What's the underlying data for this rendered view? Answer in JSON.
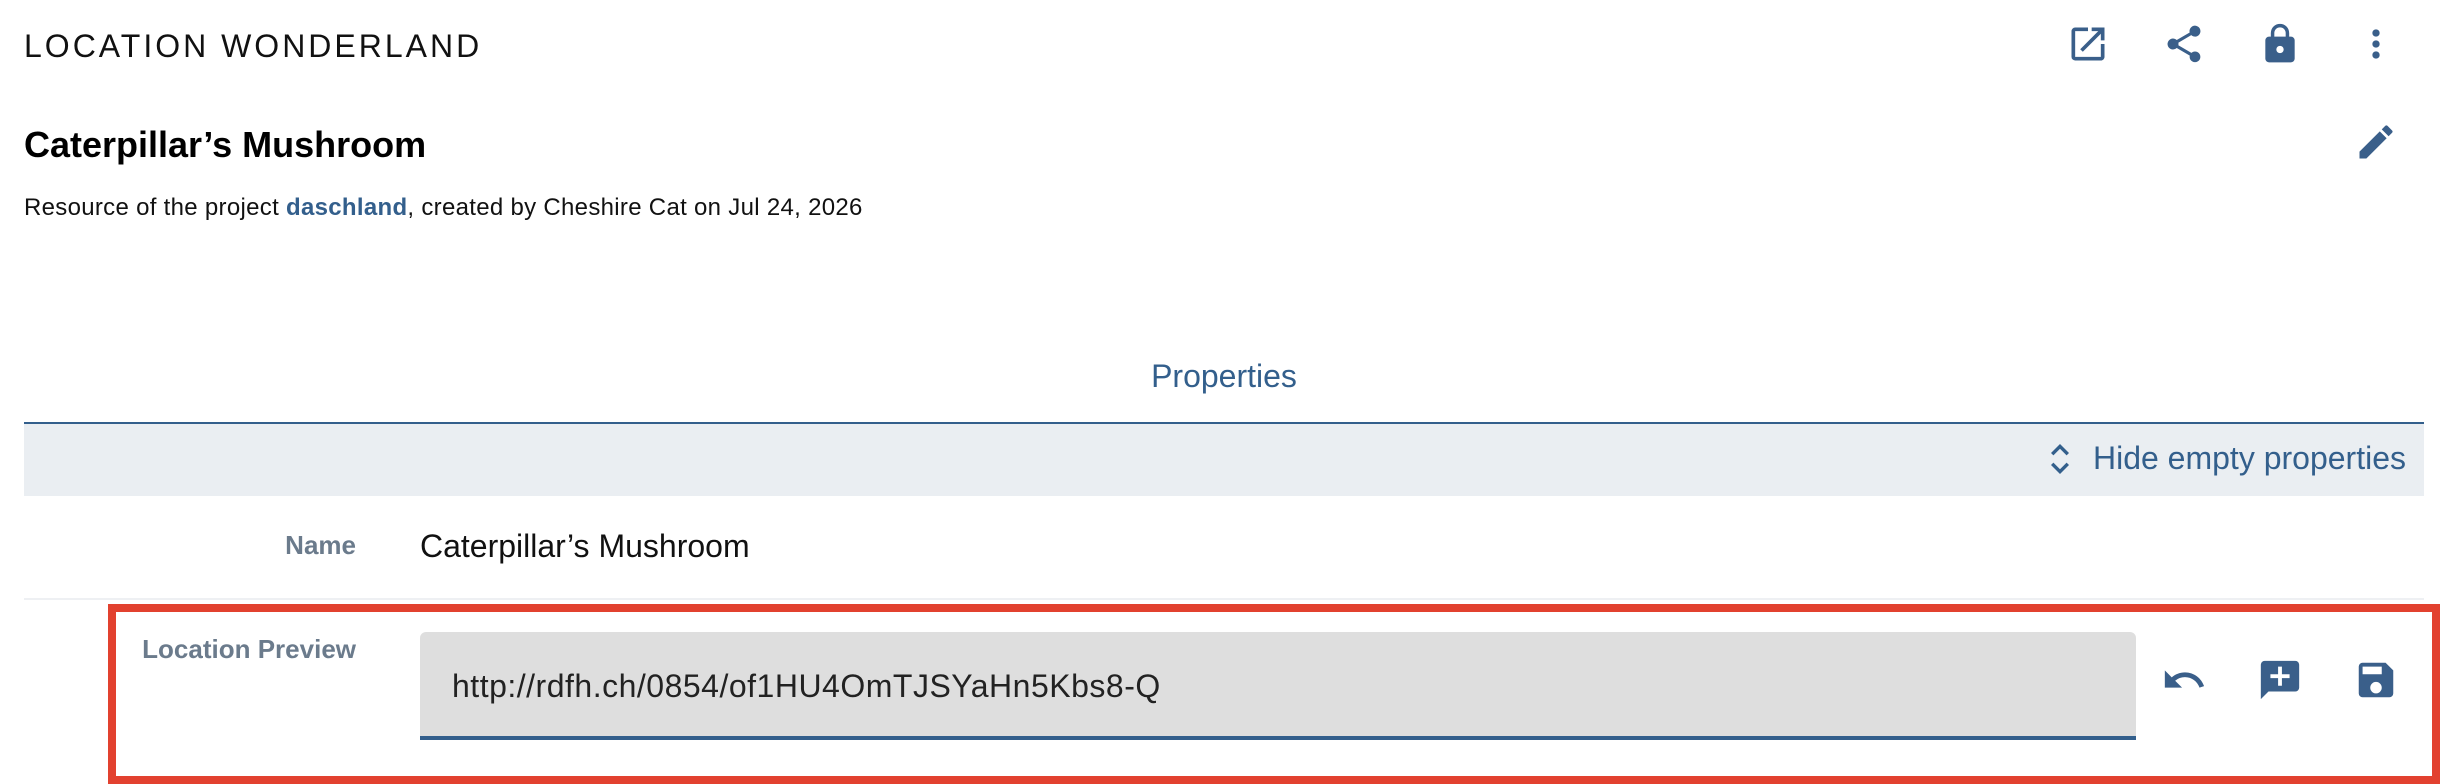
{
  "header": {
    "resource_class": "LOCATION WONDERLAND",
    "toolbar": {
      "open_icon": "open-in-new-icon",
      "share_icon": "share-icon",
      "lock_icon": "lock-icon",
      "more_icon": "more-vert-icon"
    },
    "edit_icon": "edit-icon"
  },
  "resource": {
    "title": "Caterpillar’s Mushroom",
    "meta_prefix": "Resource of the project ",
    "project": "daschland",
    "meta_suffix": ", created by Cheshire Cat on Jul 24, 2026"
  },
  "tabs": {
    "properties": "Properties"
  },
  "toggle": {
    "label": "Hide empty properties",
    "icon": "unfold-less-icon"
  },
  "properties": {
    "name": {
      "label": "Name",
      "value": "Caterpillar’s Mushroom"
    },
    "location_preview": {
      "label": "Location Preview",
      "value": "http://rdfh.ch/0854/of1HU4OmTJSYaHn5Kbs8-Q",
      "undo_icon": "undo-icon",
      "add_comment_icon": "add-comment-icon",
      "save_icon": "save-icon"
    }
  },
  "colors": {
    "accent": "#335f8c",
    "highlight": "#e2412f",
    "bar_bg": "#eaeef2",
    "input_bg": "#dedede"
  }
}
